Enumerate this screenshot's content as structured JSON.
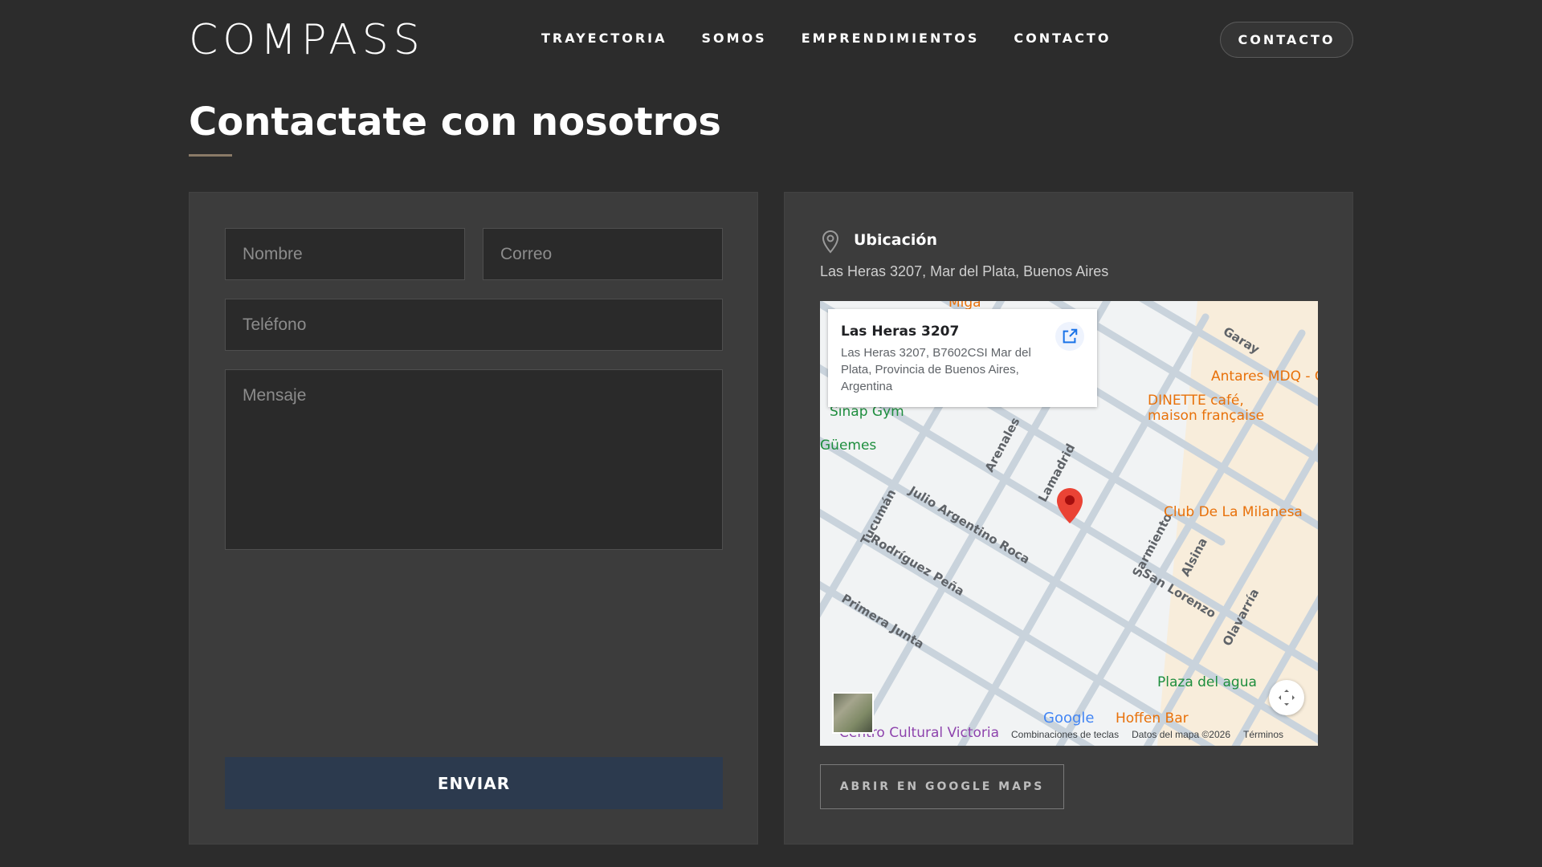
{
  "header": {
    "logo": "COMPASS",
    "nav": [
      "TRAYECTORIA",
      "SOMOS",
      "EMPRENDIMIENTOS",
      "CONTACTO"
    ],
    "cta_label": "CONTACTO"
  },
  "page": {
    "title": "Contactate con nosotros"
  },
  "form": {
    "nombre_placeholder": "Nombre",
    "correo_placeholder": "Correo",
    "telefono_placeholder": "Teléfono",
    "mensaje_placeholder": "Mensaje",
    "submit_label": "ENVIAR"
  },
  "location": {
    "title": "Ubicación",
    "address": "Las Heras 3207, Mar del Plata, Buenos Aires",
    "button_label": "ABRIR EN GOOGLE MAPS"
  },
  "map": {
    "card_title": "Las Heras 3207",
    "card_address": "Las Heras 3207, B7602CSI Mar del Plata, Provincia de Buenos Aires, Argentina",
    "streets": [
      "Julio Argentino Roca",
      "Rodríguez Peña",
      "Primera Junta",
      "San Lorenzo",
      "Sarmiento",
      "Lamadrid",
      "Arenales",
      "Tucumán",
      "Alsina",
      "Olavarría",
      "Garay",
      "Güemes"
    ],
    "pois": [
      "Antares MDQ - C",
      "DINETTE café, maison française",
      "Club De La Milanesa",
      "Sinap Gym",
      "Plaza del agua",
      "Hoffen Bar",
      "Centro Cultural Victoria",
      "Miga"
    ],
    "footer": [
      "Combinaciones de teclas",
      "Datos del mapa ©2026",
      "Términos"
    ],
    "google": "Google"
  },
  "colors": {
    "background": "#2c2c2c",
    "panel": "#3c3c3c",
    "submit": "#2c3a4e",
    "accent_underline": "#8a7a67"
  }
}
